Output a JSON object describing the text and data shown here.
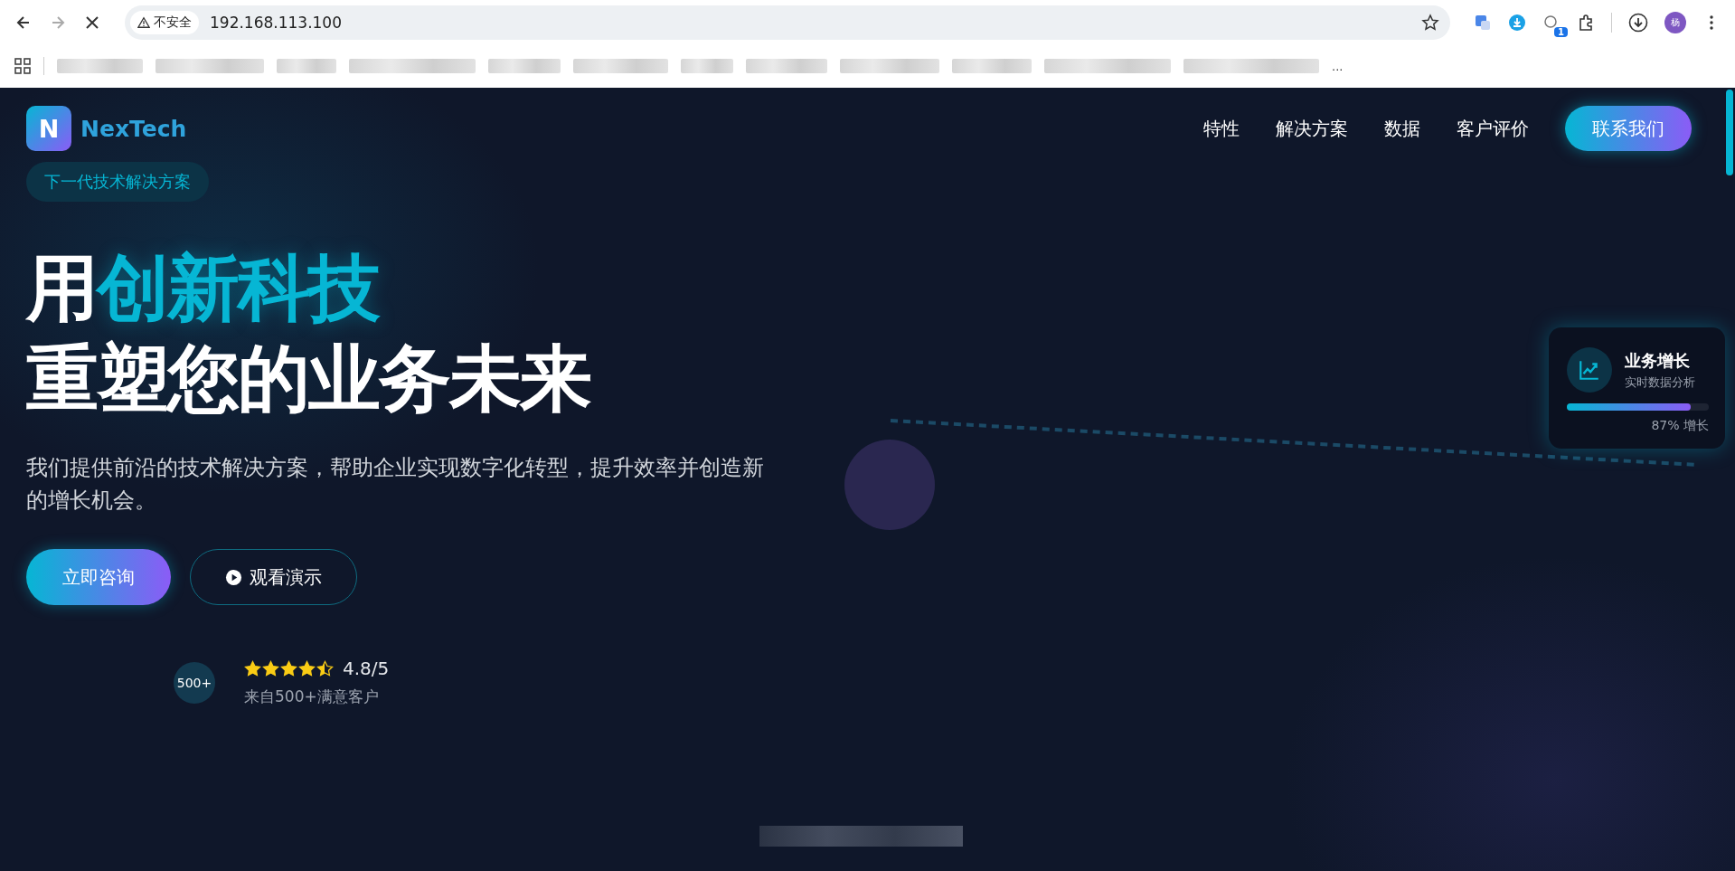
{
  "browser": {
    "security_label": "不安全",
    "url": "192.168.113.100",
    "profile_initial": "杨",
    "extension_badge": "1",
    "bookmarks_more": "..."
  },
  "nav": {
    "logo_letter": "N",
    "brand": "NexTech",
    "links": [
      "特性",
      "解决方案",
      "数据",
      "客户评价"
    ],
    "cta": "联系我们"
  },
  "hero": {
    "tagline": "下一代技术解决方案",
    "title_prefix": "用",
    "title_highlight": "创新科技",
    "title_line2": "重塑您的业务未来",
    "description": "我们提供前沿的技术解决方案，帮助企业实现数字化转型，提升效率并创造新的增长机会。",
    "primary_button": "立即咨询",
    "secondary_button": "观看演示"
  },
  "rating": {
    "badge": "500+",
    "stars": 4.5,
    "score": "4.8/5",
    "caption": "来自500+满意客户"
  },
  "growth_card": {
    "title": "业务增长",
    "subtitle": "实时数据分析",
    "level": 0.87,
    "reading": "87% 增长"
  }
}
